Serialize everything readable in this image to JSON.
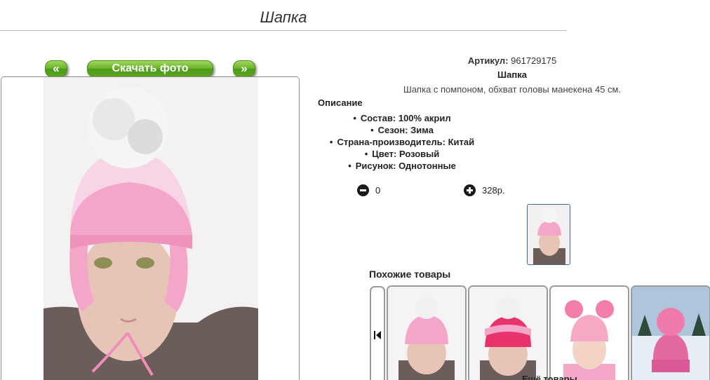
{
  "page": {
    "title": "Шапка"
  },
  "gallery": {
    "prev_label": "«",
    "download_label": "Скачать фото",
    "next_label": "»"
  },
  "product": {
    "sku_label": "Артикул:",
    "sku_value": "961729175",
    "name": "Шапка",
    "short_description": "Шапка с помпоном, обхват головы манекена 45 см.",
    "description_heading": "Описание",
    "attributes": [
      "Состав: 100% акрил",
      "Сезон: Зима",
      "Страна-производитель: Китай",
      "Цвет: Розовый",
      "Рисунок: Однотонные"
    ]
  },
  "cart": {
    "quantity": "0",
    "price": "328р."
  },
  "similar": {
    "heading": "Похожие товары",
    "more_label": "Ещё товары"
  },
  "colors": {
    "button_green": "#6cb22c",
    "hat_pink": "#f4a6c8",
    "accent_pink": "#e8336d"
  },
  "icons": {
    "minus": "minus-circle-icon",
    "plus": "plus-circle-icon",
    "carousel_prev": "skip-back-icon"
  }
}
